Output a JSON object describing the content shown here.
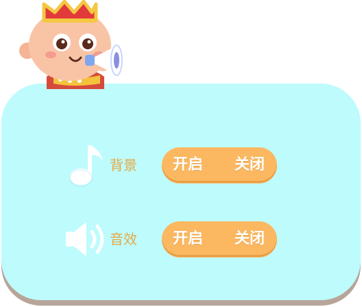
{
  "settings": {
    "music": {
      "label": "背景",
      "on_label": "开启",
      "off_label": "关闭"
    },
    "sfx": {
      "label": "音效",
      "on_label": "开启",
      "off_label": "关闭"
    }
  },
  "colors": {
    "panel": "#bdfbfd",
    "panel_shadow": "#b8a59a",
    "toggle": "#fbb861",
    "label": "#e8a843"
  },
  "icons": [
    "mascot-king-icon",
    "megaphone-icon",
    "music-note-icon",
    "speaker-icon"
  ]
}
